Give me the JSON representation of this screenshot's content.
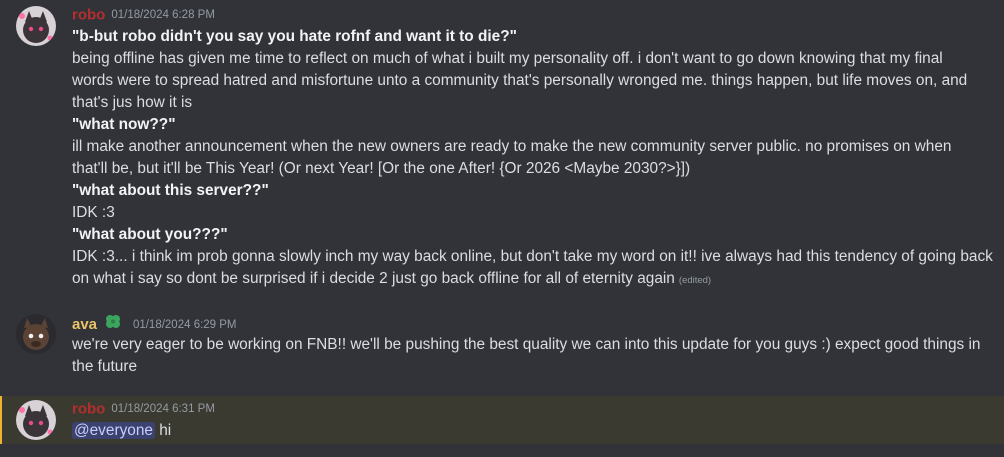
{
  "messages": [
    {
      "author": "robo",
      "author_color": "#b52e2e",
      "timestamp": "01/18/2024 6:28 PM",
      "lines": [
        {
          "text": "\"b-but robo didn't you say you hate rofnf and want it to die?\"",
          "bold": true
        },
        {
          "text": "being offline has given me time to reflect on much of what i built my personality off. i don't want to go down knowing that my final",
          "bold": false
        },
        {
          "text": "words were to spread hatred and misfortune unto a community that's personally wronged me. things happen, but life moves on, and",
          "bold": false
        },
        {
          "text": "that's jus how it is",
          "bold": false
        },
        {
          "text": "\"what now??\"",
          "bold": true
        },
        {
          "text": "ill make another announcement when the new owners are ready to make the new community server public. no promises on when",
          "bold": false
        },
        {
          "text": "that'll be, but it'll be This Year! (Or next Year! [Or the one After! {Or 2026 <Maybe 2030?>}])",
          "bold": false
        },
        {
          "text": "\"what about this server??\"",
          "bold": true
        },
        {
          "text": "IDK :3",
          "bold": false
        },
        {
          "text": "\"what about you???\"",
          "bold": true
        },
        {
          "text": "IDK :3... i think im prob gonna slowly inch my way back online, but don't take my word on it!! ive always had this tendency of going back",
          "bold": false
        },
        {
          "text": "on what i say so dont be surprised if i decide 2 just go back offline for all of eternity again",
          "bold": false
        }
      ],
      "edited_label": "(edited)"
    },
    {
      "author": "ava",
      "author_color": "#e9c46a",
      "timestamp": "01/18/2024 6:29 PM",
      "badge_icon": "clover-badge-icon",
      "lines": [
        {
          "text": "we're very eager to be working on FNB!! we'll be pushing the best quality we can into this update for you guys :) expect good things in"
        },
        {
          "text": "the future"
        }
      ]
    },
    {
      "author": "robo",
      "author_color": "#b52e2e",
      "timestamp": "01/18/2024 6:31 PM",
      "mention": "@everyone",
      "text": " hi",
      "highlight_color": "#f0b232"
    }
  ]
}
